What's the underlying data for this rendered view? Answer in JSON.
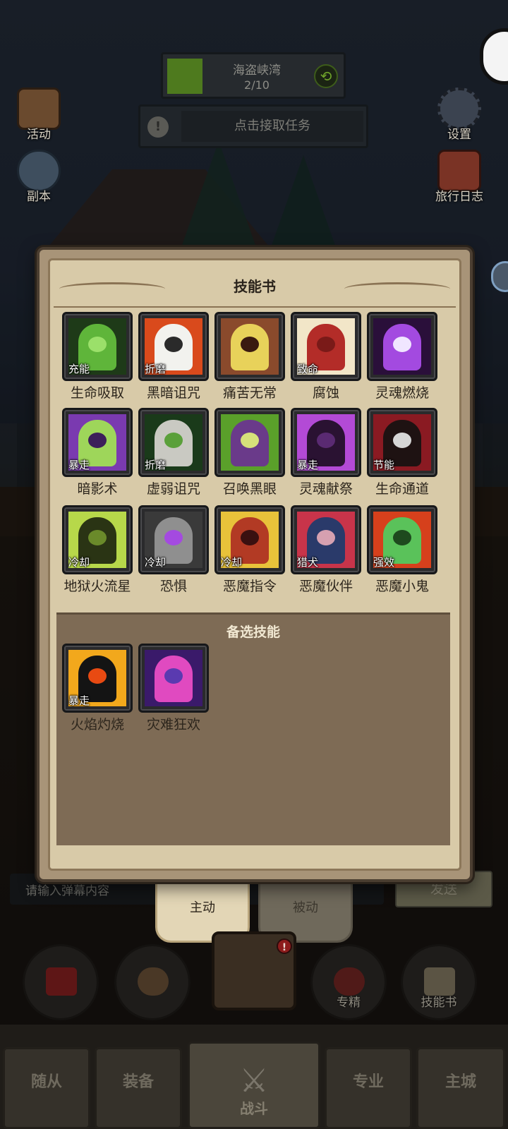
{
  "hud": {
    "activities_label": "活动",
    "dungeon_label": "副本",
    "settings_label": "设置",
    "journal_label": "旅行日志",
    "stage_name": "海盗峡湾",
    "stage_progress": "2/10",
    "task_prompt": "点击接取任务"
  },
  "chat": {
    "placeholder": "请输入弹幕内容",
    "send_label": "发送"
  },
  "tabs": {
    "active_label": "主动",
    "passive_label": "被动"
  },
  "actions": {
    "specialize_label": "专精",
    "skillbook_label": "技能书"
  },
  "nav": {
    "followers": "随从",
    "equipment": "装备",
    "battle": "战斗",
    "profession": "专业",
    "main_city": "主城"
  },
  "dialog": {
    "title": "技能书",
    "alt_title": "备选技能",
    "skills": [
      {
        "name": "生命吸取",
        "tag": "充能",
        "icon": "green-hand-icon"
      },
      {
        "name": "黑暗诅咒",
        "tag": "折磨",
        "icon": "cursed-sigil-icon"
      },
      {
        "name": "痛苦无常",
        "tag": "",
        "icon": "screaming-face-icon"
      },
      {
        "name": "腐蚀",
        "tag": "致命",
        "icon": "corroded-arm-icon"
      },
      {
        "name": "灵魂燃烧",
        "tag": "",
        "icon": "purple-skull-icon"
      },
      {
        "name": "暗影术",
        "tag": "暴走",
        "icon": "shadow-bolt-icon"
      },
      {
        "name": "虚弱诅咒",
        "tag": "折磨",
        "icon": "dagger-icon"
      },
      {
        "name": "召唤黑眼",
        "tag": "",
        "icon": "eye-demon-icon"
      },
      {
        "name": "灵魂献祭",
        "tag": "暴走",
        "icon": "raven-icon"
      },
      {
        "name": "生命通道",
        "tag": "节能",
        "icon": "blood-rune-icon"
      },
      {
        "name": "地狱火流星",
        "tag": "冷却",
        "icon": "infernal-icon"
      },
      {
        "name": "恐惧",
        "tag": "冷却",
        "icon": "fear-ghost-icon"
      },
      {
        "name": "恶魔指令",
        "tag": "冷却",
        "icon": "horned-demon-icon"
      },
      {
        "name": "恶魔伙伴",
        "tag": "猎犬",
        "icon": "demon-companion-icon"
      },
      {
        "name": "恶魔小鬼",
        "tag": "强效",
        "icon": "imp-icon"
      }
    ],
    "alt_skills": [
      {
        "name": "火焰灼烧",
        "tag": "暴走",
        "icon": "flame-silhouette-icon"
      },
      {
        "name": "灾难狂欢",
        "tag": "",
        "icon": "chaos-rune-icon"
      }
    ]
  }
}
